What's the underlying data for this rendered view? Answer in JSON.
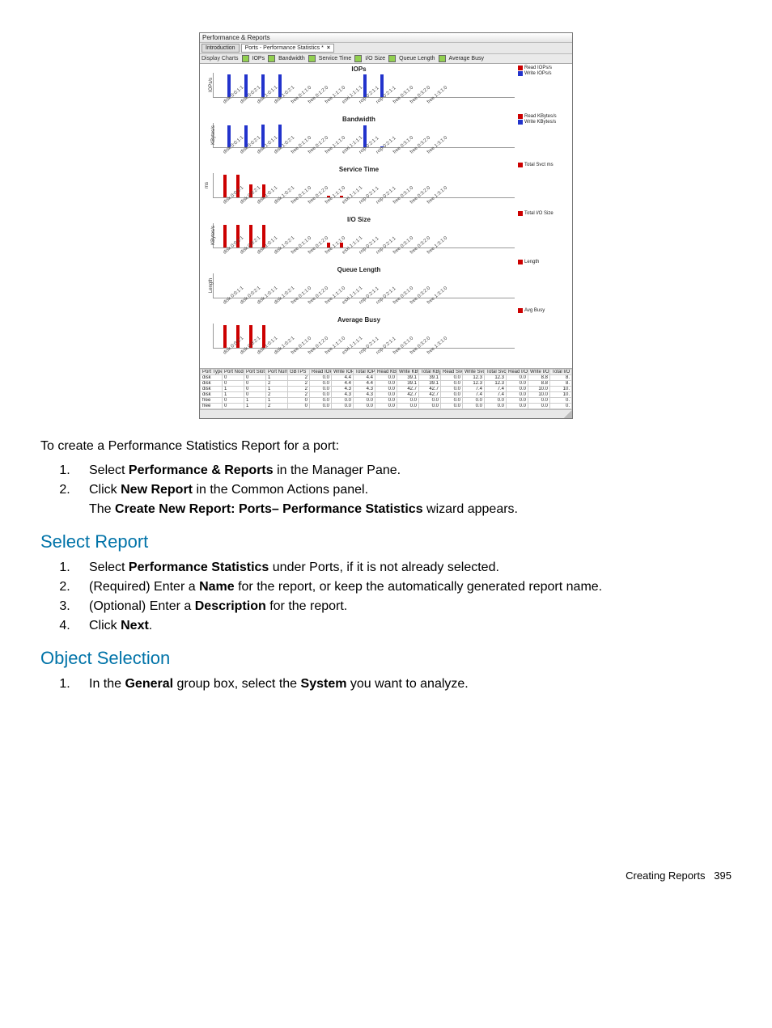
{
  "window": {
    "title": "Performance & Reports",
    "tabs": [
      {
        "label": "Introduction"
      },
      {
        "label": "Ports - Performance Statistics *"
      }
    ],
    "toolbar": {
      "label": "Display Charts",
      "opts": [
        "IOPs",
        "Bandwidth",
        "Service Time",
        "I/O Size",
        "Queue Length",
        "Average Busy"
      ]
    }
  },
  "chart_data": [
    {
      "type": "bar",
      "title": "IOPs",
      "ylabel": "IOPs/s",
      "categories": [
        "disk 0:0:1:1",
        "disk 0:0:2:1",
        "disk 1:0:1:1",
        "disk 1:0:2:1",
        "free 0:1:1:0",
        "free 0:1:2:0",
        "free 1:1:1:0",
        "esxi 1:1:1:1",
        "rcip 0:2:1:1",
        "rcip 0:2:1:1",
        "free 0:3:1:0",
        "free 0:3:2:0",
        "free 1:3:1:0"
      ],
      "series": [
        {
          "name": "Read IOPs/s",
          "values": [
            0,
            0,
            0,
            0,
            0,
            0,
            0,
            0,
            0,
            0,
            0,
            0,
            0
          ]
        },
        {
          "name": "Write IOPs/s",
          "values": [
            10,
            10,
            10,
            10,
            0,
            0,
            0,
            0,
            10,
            10,
            0,
            0,
            0
          ]
        }
      ],
      "legend": [
        "Read IOPs/s",
        "Write IOPs/s"
      ]
    },
    {
      "type": "bar",
      "title": "Bandwidth",
      "ylabel": "KBytes/s",
      "categories": [
        "disk 0:0:1:1",
        "disk 0:0:2:1",
        "disk 1:0:1:1",
        "disk 1:0:2:1",
        "free 0:1:1:0",
        "free 0:1:2:0",
        "free 1:1:1:0",
        "esxi 1:1:1:1",
        "rcip 0:2:1:1",
        "rcip 0:2:1:1",
        "free 0:3:1:0",
        "free 0:3:2:0",
        "free 1:3:1:0"
      ],
      "series": [
        {
          "name": "Read KBytes/s",
          "values": [
            0,
            0,
            0,
            0,
            0,
            0,
            0,
            0,
            0,
            0,
            0,
            0,
            0
          ]
        },
        {
          "name": "Write KBytes/s",
          "values": [
            40,
            40,
            42,
            42,
            0,
            0,
            0,
            0,
            40,
            2,
            0,
            0,
            0
          ]
        }
      ],
      "legend": [
        "Read KBytes/s",
        "Write KBytes/s"
      ]
    },
    {
      "type": "bar",
      "title": "Service Time",
      "ylabel": "ms",
      "categories": [
        "disk 0:0:1:1",
        "disk 0:0:2:1",
        "disk 1:0:1:1",
        "disk 1:0:2:1",
        "free 0:1:1:0",
        "free 0:1:2:0",
        "free 1:1:1:0",
        "esxi 1:1:1:1",
        "rcip 0:2:1:1",
        "rcip 0:2:1:1",
        "free 0:3:1:0",
        "free 0:3:2:0",
        "free 1:3:1:0"
      ],
      "series": [
        {
          "name": "Total Svct ms",
          "values": [
            12,
            12,
            7,
            7,
            0,
            0,
            0,
            0,
            1,
            1,
            0,
            0,
            0
          ]
        }
      ],
      "legend": [
        "Total Svct ms"
      ]
    },
    {
      "type": "bar",
      "title": "I/O Size",
      "ylabel": "KBytes/s",
      "categories": [
        "disk 0:0:1:1",
        "disk 0:0:2:1",
        "disk 1:0:1:1",
        "disk 1:0:2:1",
        "free 0:1:1:0",
        "free 0:1:2:0",
        "free 1:1:1:0",
        "esxi 1:1:1:1",
        "rcip 0:2:1:1",
        "rcip 0:2:1:1",
        "free 0:3:1:0",
        "free 0:3:2:0",
        "free 1:3:1:0"
      ],
      "series": [
        {
          "name": "Total I/O Size",
          "values": [
            10,
            10,
            10,
            10,
            0,
            0,
            0,
            0,
            2,
            2,
            0,
            0,
            0
          ]
        }
      ],
      "legend": [
        "Total I/O Size"
      ]
    },
    {
      "type": "bar",
      "title": "Queue Length",
      "ylabel": "Length",
      "categories": [
        "disk 0:0:1:1",
        "disk 0:0:2:1",
        "disk 1:0:1:1",
        "disk 1:0:2:1",
        "free 0:1:1:0",
        "free 0:1:2:0",
        "free 1:1:1:0",
        "esxi 1:1:1:1",
        "rcip 0:2:1:1",
        "rcip 0:2:1:1",
        "free 0:3:1:0",
        "free 0:3:2:0",
        "free 1:3:1:0"
      ],
      "series": [
        {
          "name": "Length",
          "values": [
            0,
            0,
            0,
            0,
            0,
            0,
            0,
            0,
            0,
            0,
            0,
            0,
            0
          ]
        }
      ],
      "legend": [
        "Length"
      ]
    },
    {
      "type": "bar",
      "title": "Average Busy",
      "ylabel": "",
      "categories": [
        "disk 0:0:1:1",
        "disk 0:0:2:1",
        "disk 1:0:1:1",
        "disk 1:0:2:1",
        "free 0:1:1:0",
        "free 0:1:2:0",
        "free 1:1:1:0",
        "esxi 1:1:1:1",
        "rcip 0:2:1:1",
        "rcip 0:2:1:1",
        "free 0:3:1:0",
        "free 0:3:2:0",
        "free 1:3:1:0"
      ],
      "series": [
        {
          "name": "Avg Busy",
          "values": [
            3,
            3,
            3,
            3,
            0,
            0,
            0,
            0,
            0,
            0,
            0,
            0,
            0
          ]
        }
      ],
      "legend": [
        "Avg Busy"
      ]
    }
  ],
  "table": {
    "headers": [
      "Port Type",
      "Port Node",
      "Port Slot",
      "Port Number",
      "GBTPS",
      "Read IOPs/s",
      "Write IOPs/s",
      "Total IOPs/s",
      "Read KBytes/s",
      "Write KBytes/s",
      "Total KBytes/s",
      "Read Svct ms",
      "Write Svct ms",
      "Total Svct ms",
      "Read I/O Size",
      "Write I/O Size",
      "Total I/O Size"
    ],
    "rows": [
      [
        "disk",
        "0",
        "0",
        "1",
        "2",
        "0.0",
        "4.4",
        "4.4",
        "0.0",
        "39.1",
        "39.1",
        "0.0",
        "12.3",
        "12.3",
        "0.0",
        "8.8",
        "8."
      ],
      [
        "disk",
        "0",
        "0",
        "2",
        "2",
        "0.0",
        "4.4",
        "4.4",
        "0.0",
        "39.1",
        "39.1",
        "0.0",
        "12.3",
        "12.3",
        "0.0",
        "8.8",
        "8."
      ],
      [
        "disk",
        "1",
        "0",
        "1",
        "2",
        "0.0",
        "4.3",
        "4.3",
        "0.0",
        "42.7",
        "42.7",
        "0.0",
        "7.4",
        "7.4",
        "0.0",
        "10.0",
        "10."
      ],
      [
        "disk",
        "1",
        "0",
        "2",
        "2",
        "0.0",
        "4.3",
        "4.3",
        "0.0",
        "42.7",
        "42.7",
        "0.0",
        "7.4",
        "7.4",
        "0.0",
        "10.0",
        "10."
      ],
      [
        "free",
        "0",
        "1",
        "1",
        "0",
        "0.0",
        "0.0",
        "0.0",
        "0.0",
        "0.0",
        "0.0",
        "0.0",
        "0.0",
        "0.0",
        "0.0",
        "0.0",
        "0."
      ],
      [
        "free",
        "0",
        "1",
        "2",
        "0",
        "0.0",
        "0.0",
        "0.0",
        "0.0",
        "0.0",
        "0.0",
        "0.0",
        "0.0",
        "0.0",
        "0.0",
        "0.0",
        "0."
      ]
    ]
  },
  "doc": {
    "intro": "To create a Performance Statistics Report for a port:",
    "steps1": {
      "s1a": "Select ",
      "s1b": "Performance & Reports",
      "s1c": " in the Manager Pane.",
      "s2a": "Click ",
      "s2b": "New Report",
      "s2c": " in the Common Actions panel.",
      "note_a": "The ",
      "note_b": "Create New Report: Ports– Performance Statistics",
      "note_c": " wizard appears."
    },
    "h2a": "Select Report",
    "sr": {
      "s1a": "Select ",
      "s1b": "Performance Statistics",
      "s1c": " under Ports, if it is not already selected.",
      "s2a": "(Required) Enter a ",
      "s2b": "Name",
      "s2c": " for the report, or keep the automatically generated report name.",
      "s3a": "(Optional) Enter a ",
      "s3b": "Description",
      "s3c": " for the report.",
      "s4a": "Click ",
      "s4b": "Next",
      "s4c": "."
    },
    "h2b": "Object Selection",
    "os": {
      "s1a": "In the ",
      "s1b": "General",
      "s1c": " group box, select the ",
      "s1d": "System",
      "s1e": " you want to analyze."
    },
    "footer_label": "Creating Reports",
    "footer_page": "395"
  }
}
